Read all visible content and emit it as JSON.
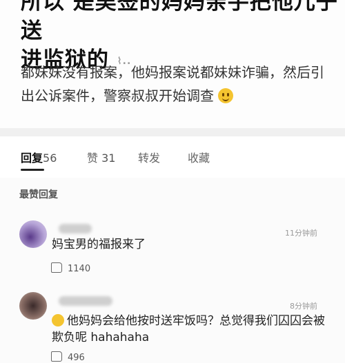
{
  "post": {
    "title_line1": "所以 是吴签的妈妈亲手把他儿子送",
    "title_line2": "进监狱的",
    "title_trail": "⌇..",
    "body": "都妹妹没有报案，他妈报案说都妹妹诈骗，然后引出公诉案件，警察叔叔开始调查"
  },
  "tabs": [
    {
      "label": "回复",
      "count": "56"
    },
    {
      "label": "赞",
      "count": "31"
    },
    {
      "label": "转发",
      "count": ""
    },
    {
      "label": "收藏",
      "count": ""
    }
  ],
  "section_title": "最赞回复",
  "comments": [
    {
      "time": "11分钟前",
      "text": "妈宝男的福报来了",
      "likes": "1140"
    },
    {
      "time": "8分钟前",
      "text": "他妈妈会给他按时送牢饭吗？总觉得我们囚囚会被欺负呢 hahahaha",
      "likes": "496"
    }
  ]
}
